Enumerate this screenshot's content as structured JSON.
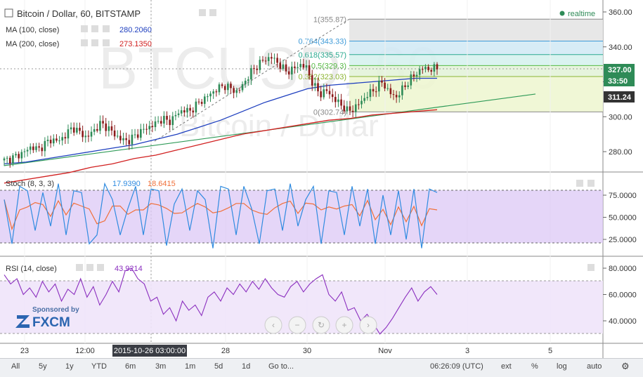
{
  "header": {
    "symbol_title": "Bitcoin / Dollar, 60, BITSTAMP",
    "realtime_label": "realtime",
    "ma100_label": "MA (100, close)",
    "ma100_value": "280.2060",
    "ma200_label": "MA (200, close)",
    "ma200_value": "273.1350",
    "stoch_label": "Stoch (8, 3, 3)",
    "stoch_k": "17.9390",
    "stoch_d": "18.6415",
    "rsi_label": "RSI (14, close)",
    "rsi_value": "43.9214"
  },
  "watermark": {
    "big": "BTCUSD, 60",
    "small": "Bitcoin / Dollar",
    "sponsor_line": "Sponsored by",
    "sponsor_brand": "FXCM"
  },
  "fib_levels": [
    {
      "label": "1(355.87)",
      "price": 355.87
    },
    {
      "label": "0.764(343.33)",
      "price": 343.33
    },
    {
      "label": "0.618(335.57)",
      "price": 335.57
    },
    {
      "label": "0.5(329.3)",
      "price": 329.3
    },
    {
      "label": "0.382(323.03)",
      "price": 323.03
    },
    {
      "label": "0(302.74)",
      "price": 302.74
    }
  ],
  "price_badges": [
    {
      "label": "327.00",
      "value": 327.0,
      "color": "#2e8b57"
    },
    {
      "label": "33:50",
      "value": 322.0,
      "color": "#2e8b57"
    },
    {
      "label": "311.24",
      "value": 311.24,
      "color": "#333333"
    }
  ],
  "x_axis": {
    "ticks": [
      "23",
      "12:00",
      "28",
      "30",
      "Nov",
      "3",
      "5"
    ],
    "cursor_label": "2015-10-26 03:00:00"
  },
  "toolbar": {
    "ranges": [
      "All",
      "5y",
      "1y",
      "YTD",
      "6m",
      "3m",
      "1m",
      "5d",
      "1d",
      "Go to..."
    ],
    "time": "06:26:09 (UTC)",
    "options": [
      "ext",
      "%",
      "log",
      "auto"
    ]
  },
  "colors": {
    "candle_up": "#2e8b57",
    "candle_down": "#8b1a1a",
    "ma100": "#1e3fbf",
    "ma200": "#d12020",
    "trend": "#2e9a57",
    "stoch_k": "#2f8be0",
    "stoch_d": "#f0703a",
    "rsi": "#8b2fbf"
  },
  "chart_data": {
    "type": "candlestick",
    "title": "Bitcoin / Dollar, 60, BITSTAMP",
    "price_axis": {
      "ylim": [
        262,
        365
      ],
      "ticks": [
        280,
        300,
        320,
        340,
        360
      ],
      "tick_labels": [
        "280.00",
        "300.00",
        "320.00",
        "340.00",
        "360.00"
      ]
    },
    "price_path": [
      275,
      276,
      278,
      280,
      283,
      281,
      285,
      287,
      286,
      290,
      294,
      291,
      288,
      292,
      296,
      294,
      290,
      287,
      286,
      289,
      292,
      294,
      296,
      299,
      297,
      301,
      304,
      303,
      307,
      310,
      313,
      316,
      318,
      316,
      314,
      320,
      326,
      330,
      333,
      334,
      330,
      326,
      327,
      330,
      328,
      318,
      313,
      315,
      310,
      307,
      303,
      305,
      309,
      313,
      316,
      320,
      314,
      311,
      316,
      321,
      325,
      328,
      327,
      328
    ],
    "ma100": [
      273,
      274,
      276,
      278,
      280,
      282,
      284,
      287,
      290,
      294,
      298,
      303,
      308,
      312,
      316,
      318,
      319,
      320,
      321,
      322,
      322
    ],
    "ma200": [
      262,
      264,
      266,
      268,
      271,
      273,
      276,
      278,
      281,
      284,
      287,
      290,
      292,
      294,
      296,
      298,
      299,
      301,
      302,
      303,
      304
    ],
    "stoch_axis": {
      "ylim": [
        10,
        90
      ],
      "ticks": [
        25,
        50,
        75
      ],
      "tick_labels": [
        "25.0000",
        "50.0000",
        "75.0000"
      ],
      "bands": [
        20,
        80
      ]
    },
    "stoch_k": [
      70,
      20,
      85,
      80,
      35,
      78,
      40,
      88,
      30,
      80,
      78,
      20,
      30,
      88,
      70,
      30,
      60,
      85,
      30,
      82,
      80,
      18,
      65,
      82,
      35,
      80,
      70,
      15,
      85,
      82,
      30,
      85,
      60,
      20,
      80,
      82,
      35,
      88,
      40,
      70,
      85,
      20,
      80,
      78,
      30,
      85,
      40,
      82,
      20,
      75,
      30,
      80,
      25,
      82,
      15,
      82,
      78
    ],
    "rsi_axis": {
      "ylim": [
        25,
        85
      ],
      "ticks": [
        40,
        60,
        80
      ],
      "tick_labels": [
        "40.0000",
        "60.0000",
        "80.0000"
      ],
      "bands": [
        30,
        70
      ]
    },
    "rsi": [
      75,
      68,
      72,
      60,
      65,
      58,
      70,
      62,
      68,
      55,
      64,
      60,
      72,
      58,
      66,
      52,
      60,
      70,
      62,
      78,
      80,
      72,
      68,
      55,
      58,
      45,
      50,
      40,
      55,
      48,
      52,
      44,
      58,
      62,
      55,
      65,
      60,
      68,
      62,
      70,
      64,
      72,
      65,
      60,
      58,
      66,
      70,
      62,
      68,
      72,
      75,
      60,
      55,
      62,
      48,
      50,
      40,
      45,
      38,
      30,
      35,
      42,
      50,
      58,
      65,
      55,
      62,
      66,
      60
    ]
  }
}
